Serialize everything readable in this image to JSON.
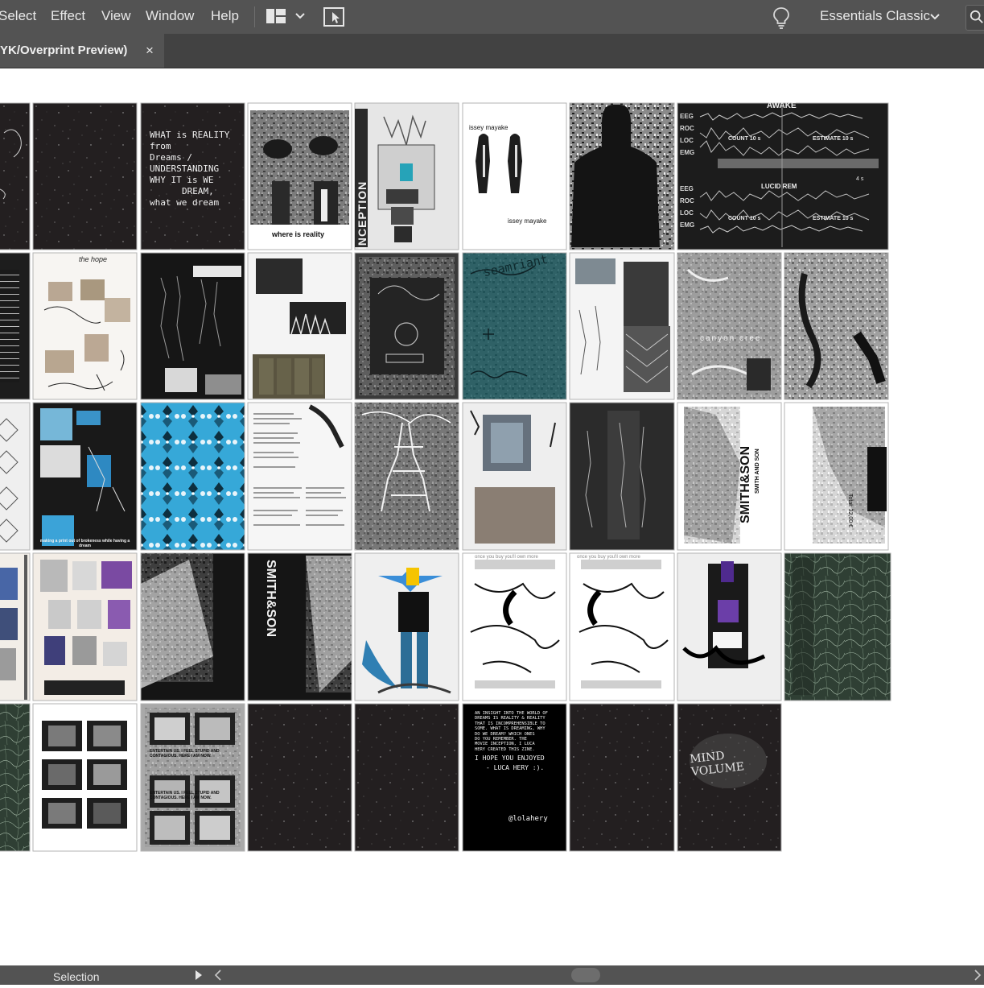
{
  "menu": {
    "items": [
      "Select",
      "Effect",
      "View",
      "Window",
      "Help"
    ],
    "workspace_label": "Essentials Classic"
  },
  "document_tab": {
    "title": "YK/Overprint Preview)",
    "close_label": "×"
  },
  "artboards": {
    "row1": {
      "a3_lines": [
        "WHAT is REALITY from",
        "Dreams / UNDERSTANDING",
        "WHY IT is WE",
        "DREAM,",
        "what we dream"
      ],
      "a4_caption": "where is reality",
      "a5_vertical": "INCEPTION",
      "a6_top": "issey mayake",
      "a6_bottom": "issey mayake",
      "a8_title": "AWAKE",
      "a8_channels": [
        "EEG",
        "ROC",
        "LOC",
        "EMG",
        "EEG",
        "ROC",
        "LOC",
        "EMG"
      ],
      "a8_counts": [
        "COUNT 10 s",
        "ESTIMATE 10 s",
        "LUCID REM",
        "4 s",
        "COUNT 10 s",
        "ESTIMATE 10 s"
      ]
    },
    "row2": {
      "b2_title": "the hope",
      "b6_text": "seamriant",
      "b8_text": "canyon cree"
    },
    "row3": {
      "c2_caption": "making a print out of brokeness while having a dream",
      "c7_vertical": "SMITH&SON",
      "c7_address": "SMITH AND SON",
      "c8_total": "Total: 32,00 €"
    },
    "row4": {
      "d4_vertical": "SMITH&SON",
      "d6_text": "once you buy you'll own more",
      "d7_text": "once you buy you'll own more"
    },
    "row5": {
      "e3_caption1": "ENTERTAIN US. I FEEL STUPID AND CONTAGIOUS. HERE I AM NOW.",
      "e3_caption2": "ENTERTAIN US. I FEEL STUPID AND CONTAGIOUS. HERE I AM NOW.",
      "e6_lines": [
        "AN INSIGHT INTO THE WORLD OF",
        "DREAMS IS REALITY & REALITY",
        "THAT IS INCOMPREHENSIBLE TO",
        "SOME. WHAT IS DREAMING, WHY",
        "DO WE DREAM? WHICH ONES",
        "DO YOU REMEMBER. THE",
        "MOVIE INCEPTION, I LUCA",
        "HERY CREATED THIS ZINE.",
        "I HOPE YOU ENJOYED",
        "- LUCA HERY :)."
      ],
      "e6_handle": "@lolahery",
      "e8_text": "MIND VOLUME"
    }
  },
  "status": {
    "mode": "Selection"
  },
  "colors": {
    "menubar": "#535353",
    "tabbar": "#424242",
    "tab_active": "#535353",
    "canvas": "#ffffff",
    "dark_board": "#231f20",
    "teal": "#1f5a60",
    "cyan_pattern": "#36a8d8"
  },
  "icons": [
    "workspace-layout-icon",
    "chevron-down-icon",
    "arrange-documents-icon",
    "lightbulb-icon",
    "search-icon",
    "close-icon",
    "play-arrow-icon",
    "scroll-left-icon",
    "scroll-right-icon"
  ]
}
